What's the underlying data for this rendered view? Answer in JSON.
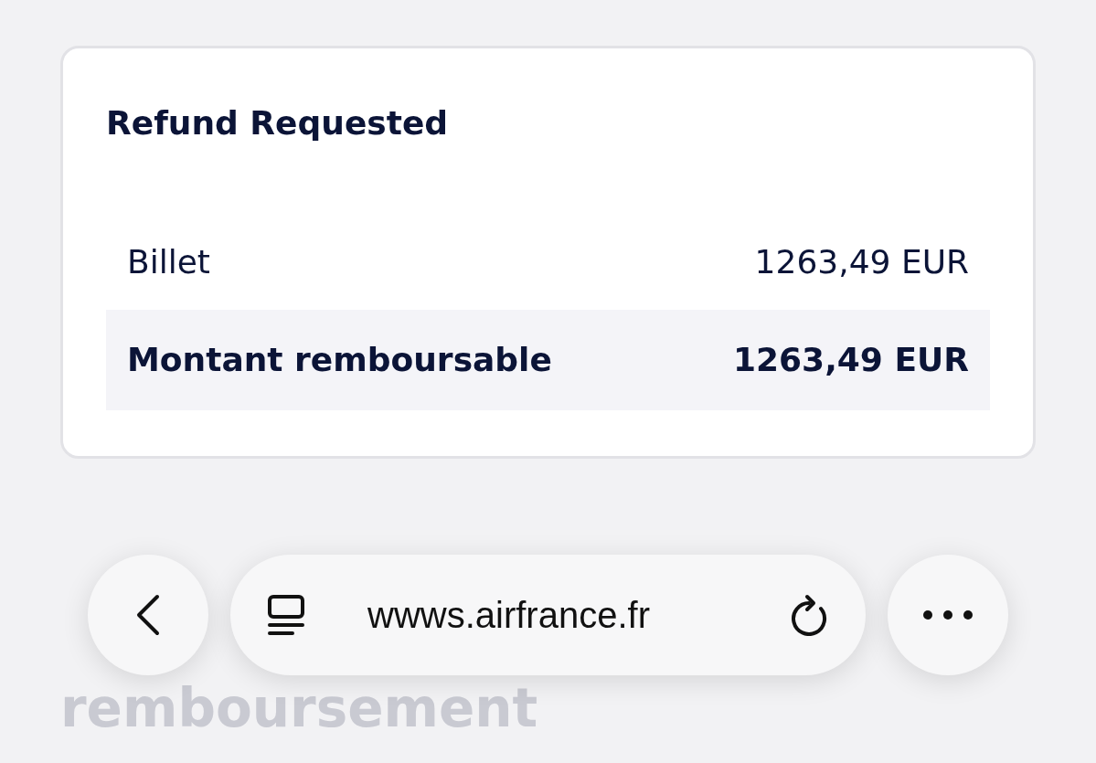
{
  "card": {
    "title": "Refund Requested",
    "rows": [
      {
        "label": "Billet",
        "amount": "1263,49 EUR",
        "highlighted": false
      },
      {
        "label": "Montant remboursable",
        "amount": "1263,49 EUR",
        "highlighted": true
      }
    ]
  },
  "heading_visible": "remboursement",
  "browser_bar": {
    "url": "wwws.airfrance.fr"
  }
}
